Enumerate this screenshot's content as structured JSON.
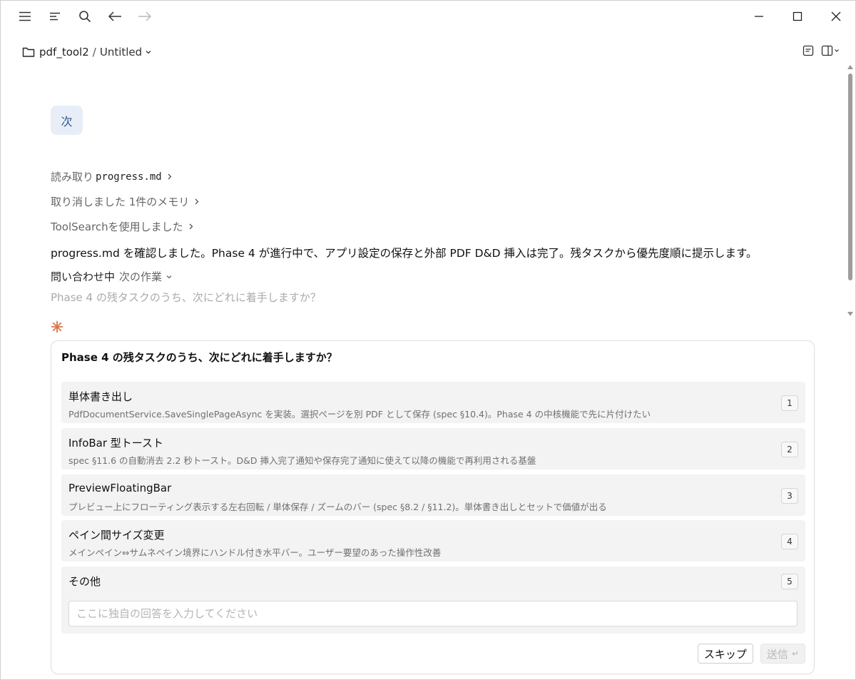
{
  "titlebar": {
    "icons": [
      "menu-icon",
      "list-icon",
      "search-icon",
      "back-arrow-icon",
      "forward-arrow-icon"
    ],
    "window_controls": [
      "minimize-icon",
      "maximize-icon",
      "close-icon"
    ]
  },
  "breadcrumb": {
    "project": "pdf_tool2",
    "separator": "/",
    "title": "Untitled"
  },
  "conversation": {
    "user_message": "次",
    "steps": {
      "read_prefix": "読み取り",
      "read_file": "progress.md",
      "memory": "取り消しました 1件のメモリ",
      "toolsearch": "ToolSearchを使用しました"
    },
    "summary": "progress.md を確認しました。Phase 4 が進行中で、アプリ設定の保存と外部 PDF D&D 挿入は完了。残タスクから優先度順に提示します。",
    "inquiry": {
      "label": "問い合わせ中",
      "topic": "次の作業",
      "question": "Phase 4 の残タスクのうち、次にどれに着手しますか？"
    }
  },
  "question_card": {
    "title": "Phase 4 の残タスクのうち、次にどれに着手しますか？",
    "options": [
      {
        "title": "単体書き出し",
        "desc": "PdfDocumentService.SaveSinglePageAsync を実装。選択ページを別 PDF として保存 (spec §10.4)。Phase 4 の中核機能で先に片付けたい",
        "key": "1"
      },
      {
        "title": "InfoBar 型トースト",
        "desc": "spec §11.6 の自動消去 2.2 秒トースト。D&D 挿入完了通知や保存完了通知に使えて以降の機能で再利用される基盤",
        "key": "2"
      },
      {
        "title": "PreviewFloatingBar",
        "desc": "プレビュー上にフローティング表示する左右回転 / 単体保存 / ズームのバー (spec §8.2 / §11.2)。単体書き出しとセットで価値が出る",
        "key": "3"
      },
      {
        "title": "ペイン間サイズ変更",
        "desc": "メインペイン⇔サムネペイン境界にハンドル付き水平バー。ユーザー要望のあった操作性改善",
        "key": "4"
      }
    ],
    "other": {
      "title": "その他",
      "key": "5",
      "placeholder": "ここに独自の回答を入力してください"
    },
    "skip_label": "スキップ",
    "send_label": "送信",
    "send_icon": "↵"
  },
  "colors": {
    "accent_bubble": "#e8eef7",
    "spark": "#d9774f",
    "option_bg": "#f3f3f3"
  }
}
